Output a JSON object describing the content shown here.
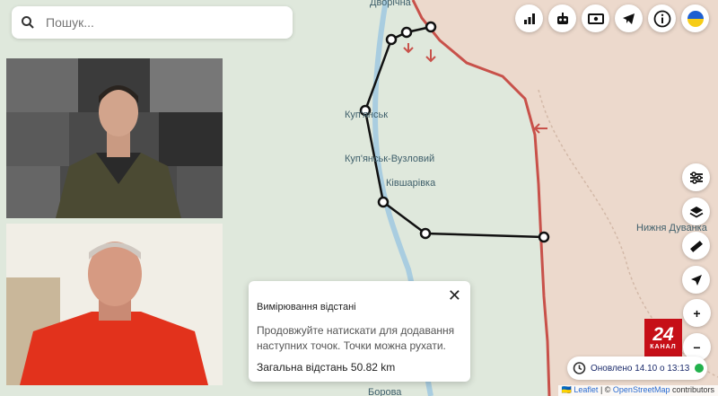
{
  "search": {
    "placeholder": "Пошук..."
  },
  "top_icons": [
    "chart-icon",
    "robot-icon",
    "money-icon",
    "telegram-icon",
    "info-icon",
    "ukraine-flag-icon"
  ],
  "side_tools": [
    "filters-icon",
    "layers-icon",
    "ruler-icon",
    "locate-icon"
  ],
  "map_labels": {
    "top_town": "Дворічна",
    "kupiansk": "Куп'янськ",
    "kupiansk_vuzlovyi": "Куп'янськ-Вузловий",
    "kivsharivka": "Ківшарівка",
    "nyzhnia_duvanka": "Нижня Дуванка",
    "bottom_town": "Борова"
  },
  "measure": {
    "title": "Вимірювання відстані",
    "hint": "Продовжуйте натискати для додавання наступних точок. Точки можна рухати.",
    "total": "Загальна відстань 50.82 km"
  },
  "logo": {
    "number": "24",
    "word": "КАНАЛ"
  },
  "zoom": {
    "in": "+",
    "out": "−"
  },
  "status": {
    "updated": "Оновлено 14.10 о 13:13"
  },
  "attribution": {
    "leaflet": "Leaflet",
    "sep": " | © ",
    "osm": "OpenStreetMap",
    "rest": " contributors",
    "flag": "🇺🇦 "
  },
  "colors": {
    "occupied": "#ecd9cc",
    "front_line": "#c8514a",
    "map_bg": "#dfe8dc",
    "river": "#a9cde0",
    "accent": "#1b2b6b"
  }
}
